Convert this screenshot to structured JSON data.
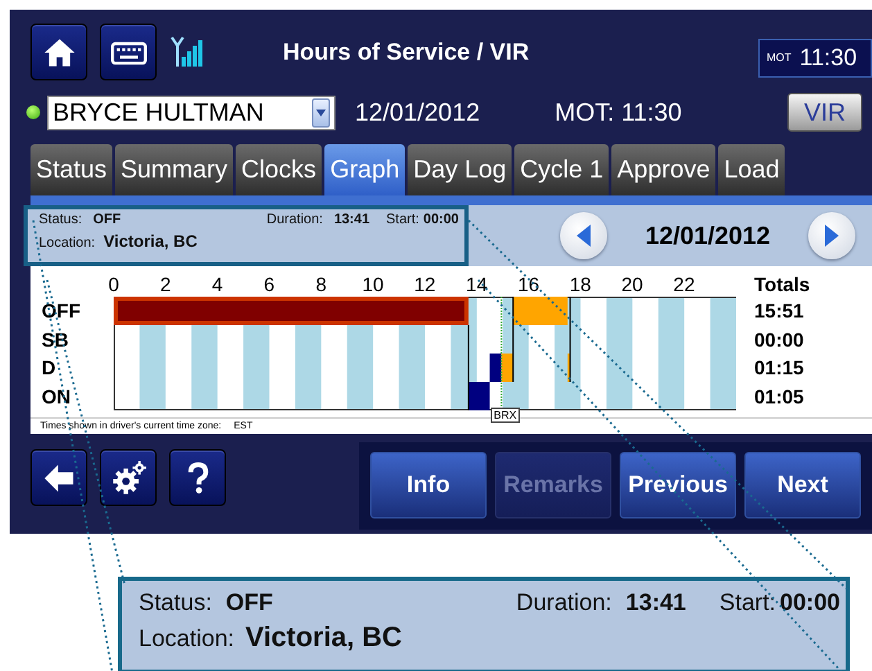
{
  "toolbar": {
    "title": "Hours of Service / VIR",
    "clock_label": "MOT",
    "clock_time": "11:30"
  },
  "driver_row": {
    "connected": true,
    "driver": "BRYCE HULTMAN",
    "date": "12/01/2012",
    "mot": "MOT: 11:30",
    "vir_button": "VIR"
  },
  "tabs": [
    {
      "label": "Status",
      "selected": false
    },
    {
      "label": "Summary",
      "selected": false
    },
    {
      "label": "Clocks",
      "selected": false
    },
    {
      "label": "Graph",
      "selected": true
    },
    {
      "label": "Day Log",
      "selected": false
    },
    {
      "label": "Cycle 1",
      "selected": false
    },
    {
      "label": "Approve",
      "selected": false
    },
    {
      "label": "Load",
      "selected": false
    }
  ],
  "status_panel": {
    "status_label": "Status:",
    "status": "OFF",
    "duration_label": "Duration:",
    "duration": "13:41",
    "start_label": "Start:",
    "start": "00:00",
    "location_label": "Location:",
    "location": "Victoria, BC"
  },
  "date_nav": {
    "date": "12/01/2012"
  },
  "graph": {
    "hours": [
      "0",
      "2",
      "4",
      "6",
      "8",
      "10",
      "12",
      "14",
      "16",
      "18",
      "20",
      "22"
    ],
    "totals_heading": "Totals",
    "rows": [
      {
        "label": "OFF",
        "total": "15:51"
      },
      {
        "label": "SB",
        "total": "00:00"
      },
      {
        "label": "D",
        "total": "01:15"
      },
      {
        "label": "ON",
        "total": "01:05"
      }
    ],
    "marker": "BRX",
    "footnote": "Times shown in driver's current time zone:",
    "time_zone": "EST"
  },
  "action_buttons": [
    {
      "label": "Info",
      "disabled": false
    },
    {
      "label": "Remarks",
      "disabled": true
    },
    {
      "label": "Previous",
      "disabled": false
    },
    {
      "label": "Next",
      "disabled": false
    }
  ],
  "callout": {
    "status_label": "Status:",
    "status": "OFF",
    "duration_label": "Duration:",
    "duration": "13:41",
    "start_label": "Start:",
    "start": "00:00",
    "location_label": "Location:",
    "location": "Victoria, BC"
  }
}
